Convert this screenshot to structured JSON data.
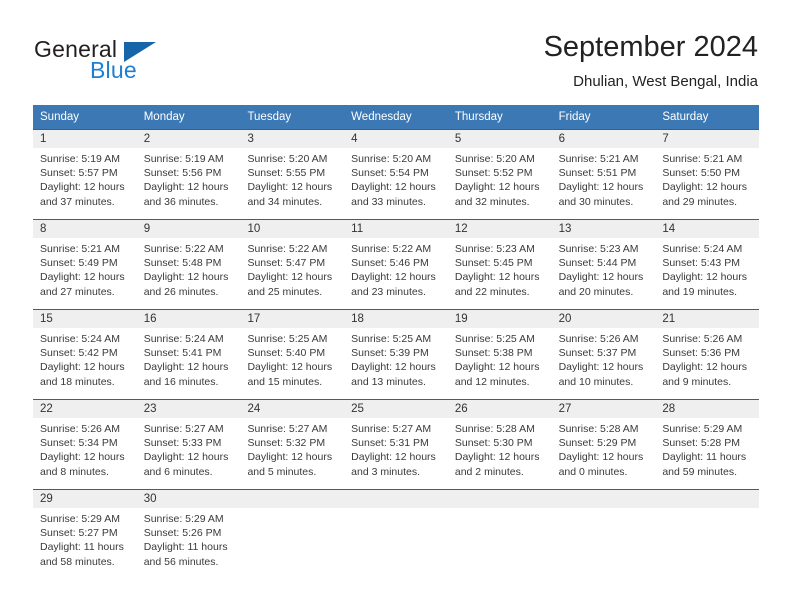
{
  "logo": {
    "word_one": "General",
    "word_two": "Blue",
    "triangle_icon": "triangle-icon"
  },
  "header": {
    "title": "September 2024",
    "subtitle": "Dhulian, West Bengal, India"
  },
  "colors": {
    "header_blue": "#3b78b4",
    "row_divider_blue": "#2f6096",
    "day_band_gray": "#efefef",
    "logo_blue": "#1c7fd4",
    "logo_triangle": "#1565a8",
    "text": "#222222"
  },
  "weekdays": [
    "Sunday",
    "Monday",
    "Tuesday",
    "Wednesday",
    "Thursday",
    "Friday",
    "Saturday"
  ],
  "weeks": [
    [
      {
        "day": "1",
        "sunrise": "Sunrise: 5:19 AM",
        "sunset": "Sunset: 5:57 PM",
        "daylight1": "Daylight: 12 hours",
        "daylight2": "and 37 minutes."
      },
      {
        "day": "2",
        "sunrise": "Sunrise: 5:19 AM",
        "sunset": "Sunset: 5:56 PM",
        "daylight1": "Daylight: 12 hours",
        "daylight2": "and 36 minutes."
      },
      {
        "day": "3",
        "sunrise": "Sunrise: 5:20 AM",
        "sunset": "Sunset: 5:55 PM",
        "daylight1": "Daylight: 12 hours",
        "daylight2": "and 34 minutes."
      },
      {
        "day": "4",
        "sunrise": "Sunrise: 5:20 AM",
        "sunset": "Sunset: 5:54 PM",
        "daylight1": "Daylight: 12 hours",
        "daylight2": "and 33 minutes."
      },
      {
        "day": "5",
        "sunrise": "Sunrise: 5:20 AM",
        "sunset": "Sunset: 5:52 PM",
        "daylight1": "Daylight: 12 hours",
        "daylight2": "and 32 minutes."
      },
      {
        "day": "6",
        "sunrise": "Sunrise: 5:21 AM",
        "sunset": "Sunset: 5:51 PM",
        "daylight1": "Daylight: 12 hours",
        "daylight2": "and 30 minutes."
      },
      {
        "day": "7",
        "sunrise": "Sunrise: 5:21 AM",
        "sunset": "Sunset: 5:50 PM",
        "daylight1": "Daylight: 12 hours",
        "daylight2": "and 29 minutes."
      }
    ],
    [
      {
        "day": "8",
        "sunrise": "Sunrise: 5:21 AM",
        "sunset": "Sunset: 5:49 PM",
        "daylight1": "Daylight: 12 hours",
        "daylight2": "and 27 minutes."
      },
      {
        "day": "9",
        "sunrise": "Sunrise: 5:22 AM",
        "sunset": "Sunset: 5:48 PM",
        "daylight1": "Daylight: 12 hours",
        "daylight2": "and 26 minutes."
      },
      {
        "day": "10",
        "sunrise": "Sunrise: 5:22 AM",
        "sunset": "Sunset: 5:47 PM",
        "daylight1": "Daylight: 12 hours",
        "daylight2": "and 25 minutes."
      },
      {
        "day": "11",
        "sunrise": "Sunrise: 5:22 AM",
        "sunset": "Sunset: 5:46 PM",
        "daylight1": "Daylight: 12 hours",
        "daylight2": "and 23 minutes."
      },
      {
        "day": "12",
        "sunrise": "Sunrise: 5:23 AM",
        "sunset": "Sunset: 5:45 PM",
        "daylight1": "Daylight: 12 hours",
        "daylight2": "and 22 minutes."
      },
      {
        "day": "13",
        "sunrise": "Sunrise: 5:23 AM",
        "sunset": "Sunset: 5:44 PM",
        "daylight1": "Daylight: 12 hours",
        "daylight2": "and 20 minutes."
      },
      {
        "day": "14",
        "sunrise": "Sunrise: 5:24 AM",
        "sunset": "Sunset: 5:43 PM",
        "daylight1": "Daylight: 12 hours",
        "daylight2": "and 19 minutes."
      }
    ],
    [
      {
        "day": "15",
        "sunrise": "Sunrise: 5:24 AM",
        "sunset": "Sunset: 5:42 PM",
        "daylight1": "Daylight: 12 hours",
        "daylight2": "and 18 minutes."
      },
      {
        "day": "16",
        "sunrise": "Sunrise: 5:24 AM",
        "sunset": "Sunset: 5:41 PM",
        "daylight1": "Daylight: 12 hours",
        "daylight2": "and 16 minutes."
      },
      {
        "day": "17",
        "sunrise": "Sunrise: 5:25 AM",
        "sunset": "Sunset: 5:40 PM",
        "daylight1": "Daylight: 12 hours",
        "daylight2": "and 15 minutes."
      },
      {
        "day": "18",
        "sunrise": "Sunrise: 5:25 AM",
        "sunset": "Sunset: 5:39 PM",
        "daylight1": "Daylight: 12 hours",
        "daylight2": "and 13 minutes."
      },
      {
        "day": "19",
        "sunrise": "Sunrise: 5:25 AM",
        "sunset": "Sunset: 5:38 PM",
        "daylight1": "Daylight: 12 hours",
        "daylight2": "and 12 minutes."
      },
      {
        "day": "20",
        "sunrise": "Sunrise: 5:26 AM",
        "sunset": "Sunset: 5:37 PM",
        "daylight1": "Daylight: 12 hours",
        "daylight2": "and 10 minutes."
      },
      {
        "day": "21",
        "sunrise": "Sunrise: 5:26 AM",
        "sunset": "Sunset: 5:36 PM",
        "daylight1": "Daylight: 12 hours",
        "daylight2": "and 9 minutes."
      }
    ],
    [
      {
        "day": "22",
        "sunrise": "Sunrise: 5:26 AM",
        "sunset": "Sunset: 5:34 PM",
        "daylight1": "Daylight: 12 hours",
        "daylight2": "and 8 minutes."
      },
      {
        "day": "23",
        "sunrise": "Sunrise: 5:27 AM",
        "sunset": "Sunset: 5:33 PM",
        "daylight1": "Daylight: 12 hours",
        "daylight2": "and 6 minutes."
      },
      {
        "day": "24",
        "sunrise": "Sunrise: 5:27 AM",
        "sunset": "Sunset: 5:32 PM",
        "daylight1": "Daylight: 12 hours",
        "daylight2": "and 5 minutes."
      },
      {
        "day": "25",
        "sunrise": "Sunrise: 5:27 AM",
        "sunset": "Sunset: 5:31 PM",
        "daylight1": "Daylight: 12 hours",
        "daylight2": "and 3 minutes."
      },
      {
        "day": "26",
        "sunrise": "Sunrise: 5:28 AM",
        "sunset": "Sunset: 5:30 PM",
        "daylight1": "Daylight: 12 hours",
        "daylight2": "and 2 minutes."
      },
      {
        "day": "27",
        "sunrise": "Sunrise: 5:28 AM",
        "sunset": "Sunset: 5:29 PM",
        "daylight1": "Daylight: 12 hours",
        "daylight2": "and 0 minutes."
      },
      {
        "day": "28",
        "sunrise": "Sunrise: 5:29 AM",
        "sunset": "Sunset: 5:28 PM",
        "daylight1": "Daylight: 11 hours",
        "daylight2": "and 59 minutes."
      }
    ],
    [
      {
        "day": "29",
        "sunrise": "Sunrise: 5:29 AM",
        "sunset": "Sunset: 5:27 PM",
        "daylight1": "Daylight: 11 hours",
        "daylight2": "and 58 minutes."
      },
      {
        "day": "30",
        "sunrise": "Sunrise: 5:29 AM",
        "sunset": "Sunset: 5:26 PM",
        "daylight1": "Daylight: 11 hours",
        "daylight2": "and 56 minutes."
      },
      {
        "day": "",
        "sunrise": "",
        "sunset": "",
        "daylight1": "",
        "daylight2": ""
      },
      {
        "day": "",
        "sunrise": "",
        "sunset": "",
        "daylight1": "",
        "daylight2": ""
      },
      {
        "day": "",
        "sunrise": "",
        "sunset": "",
        "daylight1": "",
        "daylight2": ""
      },
      {
        "day": "",
        "sunrise": "",
        "sunset": "",
        "daylight1": "",
        "daylight2": ""
      },
      {
        "day": "",
        "sunrise": "",
        "sunset": "",
        "daylight1": "",
        "daylight2": ""
      }
    ]
  ]
}
